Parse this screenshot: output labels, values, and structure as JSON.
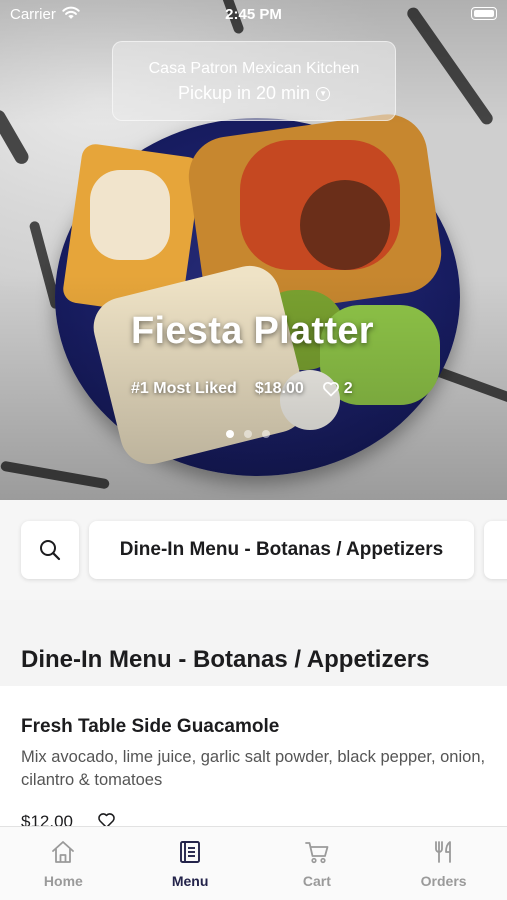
{
  "status_bar": {
    "carrier": "Carrier",
    "time": "2:45 PM"
  },
  "location": {
    "name": "Casa Patron Mexican Kitchen",
    "pickup": "Pickup in 20 min"
  },
  "featured": {
    "title": "Fiesta Platter",
    "rank": "#1 Most Liked",
    "price": "$18.00",
    "likes": "2",
    "carousel_pages": 3,
    "active_page": 1
  },
  "filter": {
    "category": "Dine-In Menu - Botanas / Appetizers"
  },
  "section": {
    "title": "Dine-In Menu - Botanas / Appetizers"
  },
  "items": [
    {
      "name": "Fresh Table Side Guacamole",
      "description": "Mix avocado, lime juice, garlic salt powder, black pepper, onion, cilantro & tomatoes",
      "price": "$12.00"
    }
  ],
  "tabs": [
    {
      "label": "Home",
      "icon": "home-icon",
      "active": false
    },
    {
      "label": "Menu",
      "icon": "menu-book-icon",
      "active": true
    },
    {
      "label": "Cart",
      "icon": "cart-icon",
      "active": false
    },
    {
      "label": "Orders",
      "icon": "fork-knife-icon",
      "active": false
    }
  ],
  "colors": {
    "active_tab": "#23234a",
    "inactive_tab": "#9a9a9a",
    "plate": "#1a1f66"
  }
}
